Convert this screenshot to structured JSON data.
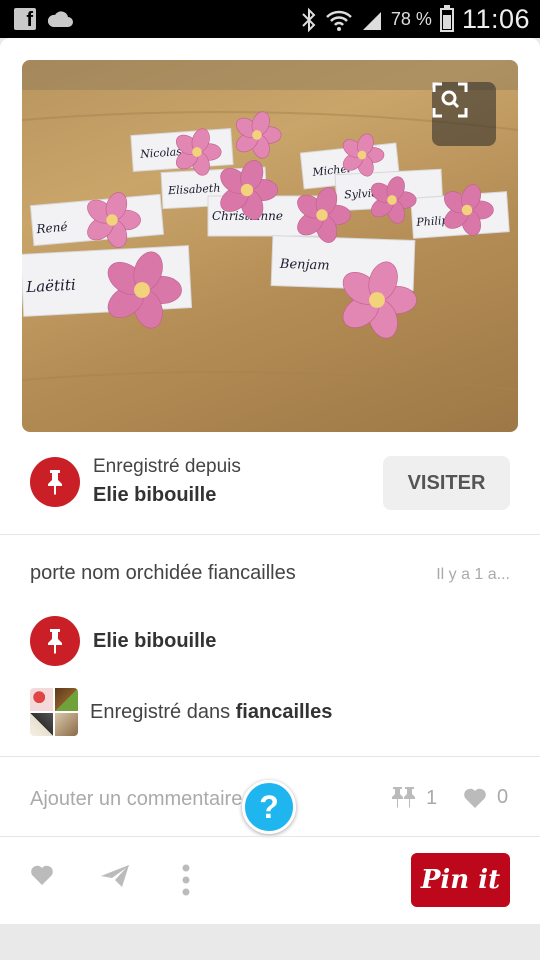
{
  "status_bar": {
    "battery_text": "78 %",
    "time": "11:06",
    "icons": [
      "facebook-icon",
      "cloud-icon",
      "bluetooth-icon",
      "wifi-icon",
      "signal-icon",
      "battery-icon"
    ]
  },
  "pin": {
    "image_alt": "",
    "place_cards": [
      "Nicolas",
      "Elisabeth",
      "Michel",
      "René",
      "Christianne",
      "Sylvie",
      "Philippe",
      "Benjam",
      "Laëtiti"
    ],
    "saved_from_label": "Enregistré depuis",
    "source_name": "Elie bibouille",
    "visit_label": "VISITER",
    "description": "porte nom orchidée fiancailles",
    "time_ago": "Il y a 1 a...",
    "pinner_name": "Elie bibouille",
    "saved_in_prefix": "Enregistré dans",
    "board_name": "fiancailles"
  },
  "comments": {
    "placeholder": "Ajouter un commentaire",
    "help_label": "?",
    "repin_count": "1",
    "like_count": "0"
  },
  "actions": {
    "pinit_label": "Pin it"
  },
  "colors": {
    "accent_red": "#bd081c",
    "avatar_red": "#cb1f27",
    "help_blue": "#1fb6f0"
  }
}
